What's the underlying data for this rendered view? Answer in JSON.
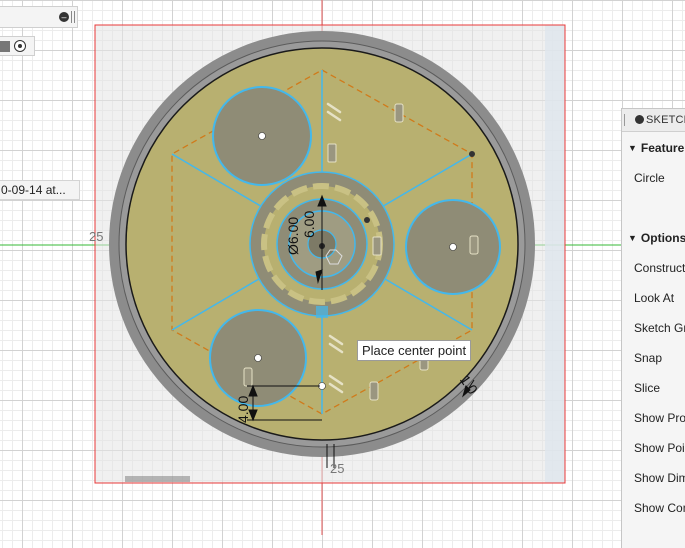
{
  "browser": {
    "collapse_icon": "minus-circle-icon",
    "visibility_icon": "radio-visible-icon",
    "timeline_label": "0-09-14 at..."
  },
  "canvas": {
    "dims": {
      "left_25": "25",
      "bottom_25": "25",
      "diameter_6": "Ø6.00",
      "dim_600": "6.00",
      "dim_400": "4.00",
      "dim_10": "1.0"
    },
    "colors": {
      "plate": "#b8b070",
      "rim": "#8c8c8c",
      "sketch": "#43b8ec",
      "construction": "#d07a1a",
      "selection_box": "#e83838",
      "origin_x": "#36b836",
      "origin_y": "#e45757"
    }
  },
  "tooltip": {
    "text": "Place center point"
  },
  "sketch_palette": {
    "title": "SKETCH",
    "feature_section": "Feature",
    "feature_item": "Circle",
    "options_section": "Options",
    "options": [
      "Construct",
      "Look At",
      "Sketch Gr",
      "Snap",
      "Slice",
      "Show Prof",
      "Show Poin",
      "Show Dim",
      "Show Con"
    ]
  }
}
